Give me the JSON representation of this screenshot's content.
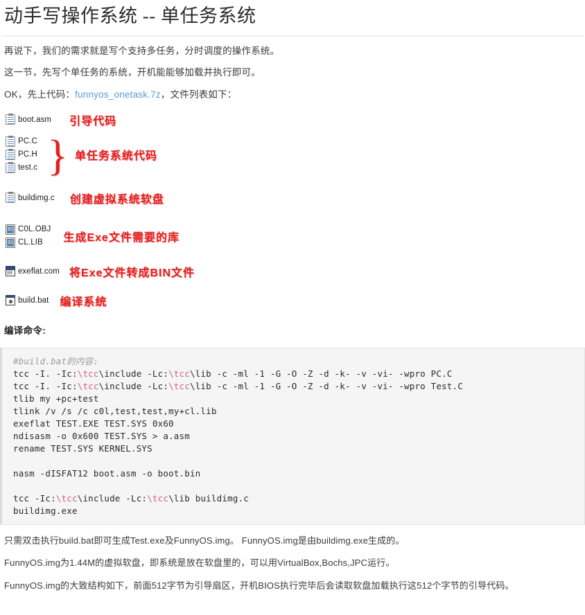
{
  "title": "动手写操作系统 -- 单任务系统",
  "intro": {
    "p1": "再说下，我们的需求就是写个支持多任务，分时调度的操作系统。",
    "p2": "这一节，先写个单任务的系统，开机能能够加载并执行即可。",
    "p3_before": "OK，先上代码：",
    "p3_link": "funnyos_onetask.7z",
    "p3_after": "，文件列表如下："
  },
  "filelist": [
    {
      "icon": "document-icon",
      "files": [
        "boot.asm"
      ],
      "annotation": "引导代码",
      "brace": false
    },
    {
      "icon": "document-icon",
      "files": [
        "PC.C",
        "PC.H",
        "test.c"
      ],
      "annotation": "单任务系统代码",
      "brace": true,
      "brace_glyph": "}"
    },
    {
      "icon": "document-icon",
      "files": [
        "buildimg.c"
      ],
      "annotation": "创建虚拟系统软盘",
      "brace": false
    },
    {
      "icon": "binary-icon",
      "files": [
        "C0L.OBJ",
        "CL.LIB"
      ],
      "annotation": "生成Exe文件需要的库",
      "brace": false
    },
    {
      "icon": "dos-application-icon",
      "files": [
        "exeflat.com"
      ],
      "annotation": "将Exe文件转成BIN文件",
      "brace": false
    },
    {
      "icon": "batch-file-icon",
      "files": [
        "build.bat"
      ],
      "annotation": "编译系统",
      "brace": false
    }
  ],
  "sub_heading": "编译命令:",
  "code": {
    "comment": "#build.bat的内容:",
    "lines": [
      {
        "prefix": "tcc -I. -Ic:",
        "path": "\\tcc",
        "mid": "\\include -Lc:",
        "path2": "\\tcc",
        "suffix": "\\lib -c -ml -1 -G -O -Z -d -k- -v -vi- -wpro PC.C"
      },
      {
        "prefix": "tcc -I. -Ic:",
        "path": "\\tcc",
        "mid": "\\include -Lc:",
        "path2": "\\tcc",
        "suffix": "\\lib -c -ml -1 -G -O -Z -d -k- -v -vi- -wpro Test.C"
      },
      {
        "plain": "tlib my +pc+test"
      },
      {
        "plain": "tlink /v /s /c c0l,test,test,my+cl.lib"
      },
      {
        "plain": "exeflat TEST.EXE TEST.SYS 0x60"
      },
      {
        "plain": "ndisasm -o 0x600 TEST.SYS > a.asm"
      },
      {
        "plain": "rename TEST.SYS KERNEL.SYS"
      },
      {
        "blank": true
      },
      {
        "plain": "nasm -dISFAT12 boot.asm -o boot.bin"
      },
      {
        "blank": true
      },
      {
        "prefix": "tcc -Ic:",
        "path": "\\tcc",
        "mid": "\\include -Lc:",
        "path2": "\\tcc",
        "suffix": "\\lib buildimg.c"
      },
      {
        "plain": "buildimg.exe"
      }
    ]
  },
  "footer": {
    "p1": "只需双击执行build.bat即可生成Test.exe及FunnyOS.img。 FunnyOS.img是由buildimg.exe生成的。",
    "p2": "FunnyOS.img为1.44M的虚拟软盘，即系统是放在软盘里的，可以用VirtualBox,Bochs,JPC运行。",
    "p3": "FunnyOS.img的大致结构如下，前面512字节为引导扇区，开机BIOS执行完毕后会读取软盘加载执行这512个字节的引导代码。"
  },
  "colors": {
    "annotation_red": "#e02020",
    "link_blue": "#5b9bd5",
    "code_path": "#d4607a",
    "code_comment": "#999999",
    "code_bg": "#f5f5f5"
  }
}
